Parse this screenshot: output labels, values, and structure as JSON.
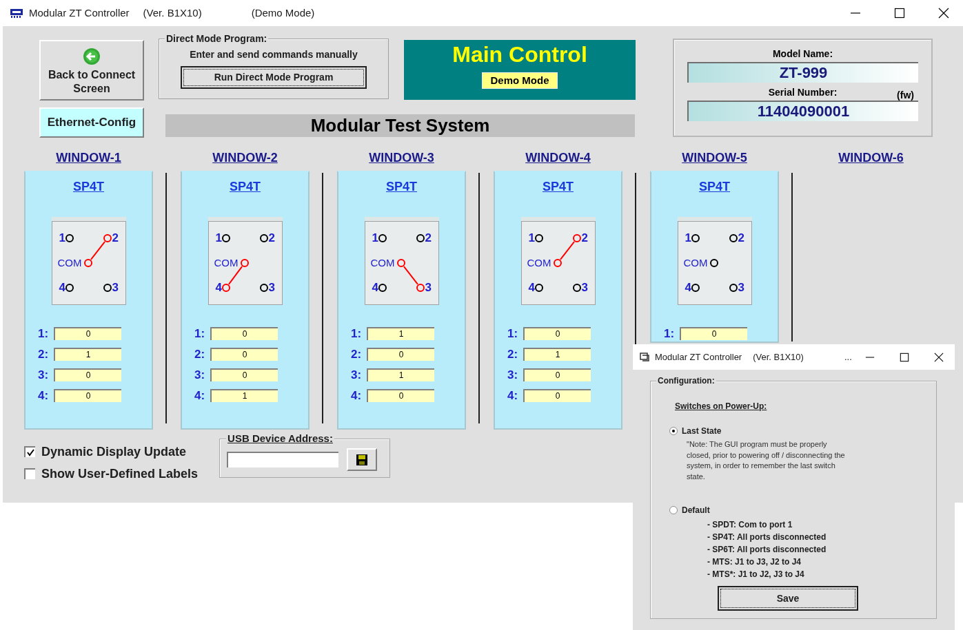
{
  "window": {
    "title": "Modular ZT Controller",
    "version": "(Ver. B1X10)",
    "mode": "(Demo Mode)"
  },
  "back_button": "Back to Connect Screen",
  "ethernet_button": "Ethernet-Config",
  "direct_mode": {
    "legend": "Direct Mode Program:",
    "hint": "Enter and send commands manually",
    "button": "Run Direct Mode Program"
  },
  "main_control": {
    "title": "Main Control",
    "mode_badge": "Demo Mode"
  },
  "system_title": "Modular Test System",
  "model": {
    "model_label": "Model Name:",
    "model_value": "ZT-999",
    "serial_label": "Serial Number:",
    "fw_label": "(fw)",
    "serial_value": "11404090001"
  },
  "windows": [
    {
      "label": "WINDOW-1",
      "switch": {
        "type": "SP4T",
        "com_label": "COM",
        "ports": [
          {
            "label": "1",
            "connected": false
          },
          {
            "label": "2",
            "connected": true
          },
          {
            "label": "4",
            "connected": false
          },
          {
            "label": "3",
            "connected": false
          }
        ]
      },
      "readings": [
        {
          "label": "1:",
          "value": "0"
        },
        {
          "label": "2:",
          "value": "1"
        },
        {
          "label": "3:",
          "value": "0"
        },
        {
          "label": "4:",
          "value": "0"
        }
      ]
    },
    {
      "label": "WINDOW-2",
      "switch": {
        "type": "SP4T",
        "com_label": "COM",
        "ports": [
          {
            "label": "1",
            "connected": false
          },
          {
            "label": "2",
            "connected": false
          },
          {
            "label": "4",
            "connected": true
          },
          {
            "label": "3",
            "connected": false
          }
        ]
      },
      "readings": [
        {
          "label": "1:",
          "value": "0"
        },
        {
          "label": "2:",
          "value": "0"
        },
        {
          "label": "3:",
          "value": "0"
        },
        {
          "label": "4:",
          "value": "1"
        }
      ]
    },
    {
      "label": "WINDOW-3",
      "switch": {
        "type": "SP4T",
        "com_label": "COM",
        "ports": [
          {
            "label": "1",
            "connected": false
          },
          {
            "label": "2",
            "connected": false
          },
          {
            "label": "4",
            "connected": false
          },
          {
            "label": "3",
            "connected": true
          }
        ]
      },
      "readings": [
        {
          "label": "1:",
          "value": "1"
        },
        {
          "label": "2:",
          "value": "0"
        },
        {
          "label": "3:",
          "value": "1"
        },
        {
          "label": "4:",
          "value": "0"
        }
      ]
    },
    {
      "label": "WINDOW-4",
      "switch": {
        "type": "SP4T",
        "com_label": "COM",
        "ports": [
          {
            "label": "1",
            "connected": false
          },
          {
            "label": "2",
            "connected": true
          },
          {
            "label": "4",
            "connected": false
          },
          {
            "label": "3",
            "connected": false
          }
        ]
      },
      "readings": [
        {
          "label": "1:",
          "value": "0"
        },
        {
          "label": "2:",
          "value": "1"
        },
        {
          "label": "3:",
          "value": "0"
        },
        {
          "label": "4:",
          "value": "0"
        }
      ]
    },
    {
      "label": "WINDOW-5",
      "switch": {
        "type": "SP4T",
        "com_label": "COM",
        "ports": [
          {
            "label": "1",
            "connected": false
          },
          {
            "label": "2",
            "connected": false
          },
          {
            "label": "4",
            "connected": false
          },
          {
            "label": "3",
            "connected": false
          }
        ]
      },
      "readings": [
        {
          "label": "1:",
          "value": "0"
        }
      ]
    },
    {
      "label": "WINDOW-6"
    }
  ],
  "options": [
    {
      "label": "Dynamic Display Update",
      "checked": true
    },
    {
      "label": "Show User-Defined Labels",
      "checked": false
    }
  ],
  "usb": {
    "legend": "USB Device Address:"
  },
  "dialog": {
    "title": "Modular ZT Controller",
    "version": "(Ver. B1X10)",
    "overflow": "...",
    "legend": "Configuration:",
    "heading": "Switches on Power-Up:",
    "choices": [
      {
        "label": "Last State",
        "selected": true,
        "lines": [
          "\"Note: The GUI program must be properly closed, prior to powering off / disconnecting the system, in order to remember the last switch state."
        ]
      },
      {
        "label": "Default",
        "selected": false,
        "lines": [
          "- SPDT: Com to port 1",
          "- SP4T: All ports disconnected",
          "- SP6T: All ports disconnected",
          "- MTS: J1 to J3, J2 to J4",
          "- MTS*: J1 to J2, J3 to J4"
        ]
      }
    ],
    "button": "Save"
  }
}
